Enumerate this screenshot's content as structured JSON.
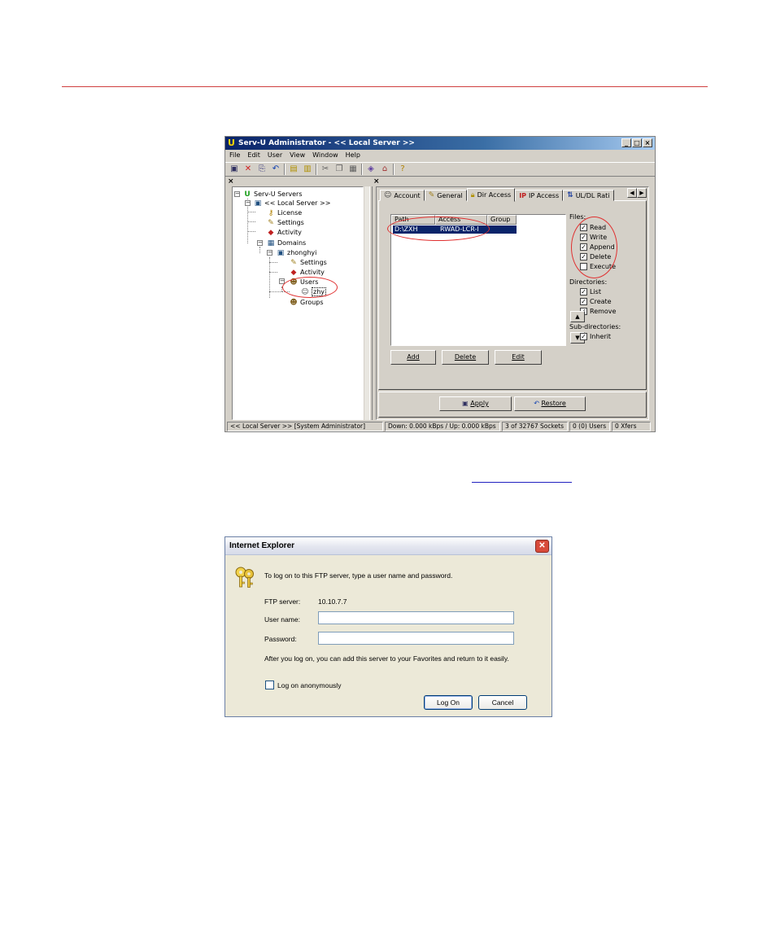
{
  "servu": {
    "title": "Serv-U Administrator - << Local Server >>",
    "menu": [
      "File",
      "Edit",
      "User",
      "View",
      "Window",
      "Help"
    ],
    "toolbar_icons": [
      "save-icon",
      "delete-icon",
      "copy-icon",
      "undo-icon",
      "up-folder-icon",
      "refresh-icon",
      "cut-icon",
      "copy2-icon",
      "paste-icon",
      "book-icon",
      "home-icon",
      "help-icon"
    ],
    "pane_close_glyph": "×",
    "tree": {
      "root": "Serv-U Servers",
      "server": "<< Local Server >>",
      "license": "License",
      "settings": "Settings",
      "activity": "Activity",
      "domains": "Domains",
      "domain": "zhonghyi",
      "domain_settings": "Settings",
      "domain_activity": "Activity",
      "users": "Users",
      "user": "zhy",
      "groups": "Groups"
    },
    "tabs": [
      "Account",
      "General",
      "Dir Access",
      "IP Access",
      "UL/DL Rati"
    ],
    "tab_icons": [
      "account-icon",
      "general-icon",
      "lock-icon",
      "ip-icon",
      "ratio-icon"
    ],
    "active_tab": "Dir Access",
    "list": {
      "headers": [
        "Path",
        "Access",
        "Group"
      ],
      "rows": [
        {
          "path": "D:\\ZXH",
          "access": "RWAD-LCR-I"
        }
      ]
    },
    "buttons": {
      "add": "Add",
      "delete": "Delete",
      "edit": "Edit",
      "apply": "Apply",
      "restore": "Restore"
    },
    "files_label": "Files:",
    "files": [
      {
        "label": "Read",
        "checked": true
      },
      {
        "label": "Write",
        "checked": true
      },
      {
        "label": "Append",
        "checked": true
      },
      {
        "label": "Delete",
        "checked": true
      },
      {
        "label": "Execute",
        "checked": false
      }
    ],
    "directories_label": "Directories:",
    "directories": [
      {
        "label": "List",
        "checked": true
      },
      {
        "label": "Create",
        "checked": true
      },
      {
        "label": "Remove",
        "checked": true
      }
    ],
    "subdirectories_label": "Sub-directories:",
    "subdirectories": [
      {
        "label": "Inherit",
        "checked": true
      }
    ],
    "statusbar": [
      "<< Local Server >>   [System Administrator]",
      "Down: 0.000 kBps / Up: 0.000 kBps",
      "3 of 32767 Sockets",
      "0 (0) Users",
      "0 Xfers"
    ]
  },
  "ie": {
    "title": "Internet Explorer",
    "intro": "To log on to this FTP server, type a user name and password.",
    "ftp_server_label": "FTP server:",
    "ftp_server_value": "10.10.7.7",
    "username_label": "User name:",
    "username_value": "",
    "password_label": "Password:",
    "password_value": "",
    "note": "After you log on, you can add this server to your Favorites and return to it easily.",
    "anonymous_label": "Log on anonymously",
    "anonymous_checked": false,
    "logon_button": "Log On",
    "cancel_button": "Cancel"
  }
}
